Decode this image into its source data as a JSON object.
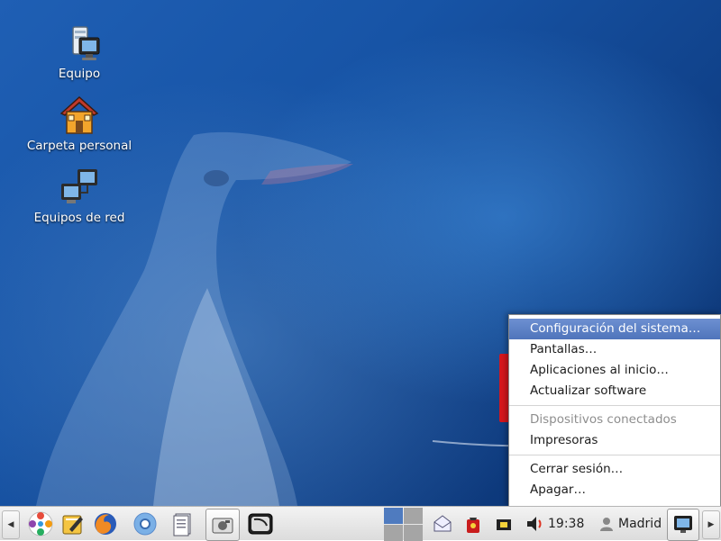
{
  "desktop": {
    "icons": [
      {
        "label": "Equipo",
        "icon": "computer-icon"
      },
      {
        "label": "Carpeta personal",
        "icon": "home-folder-icon"
      },
      {
        "label": "Equipos de red",
        "icon": "network-icon"
      }
    ]
  },
  "menu": {
    "items": [
      {
        "label": "Configuración del sistema…",
        "state": "highlighted"
      },
      {
        "label": "Pantallas…"
      },
      {
        "label": "Aplicaciones al inicio…"
      },
      {
        "label": "Actualizar software"
      },
      {
        "label": "Dispositivos conectados",
        "state": "disabled"
      },
      {
        "label": "Impresoras"
      },
      {
        "label": "Cerrar sesión…"
      },
      {
        "label": "Apagar…"
      }
    ]
  },
  "taskbar": {
    "clock": "19:38",
    "user": "Madrid",
    "launchers": [
      "app-menu-icon",
      "notes-icon",
      "firefox-icon",
      "chromium-icon",
      "document-icon",
      "screenshot-icon",
      "terminal-icon"
    ],
    "tray": [
      "mail-icon",
      "updates-icon",
      "network-icon",
      "volume-icon"
    ],
    "colors": {
      "menu_highlight": "#5b80c6",
      "accent_red": "#d6161c",
      "desktop": "#1754a6"
    }
  }
}
